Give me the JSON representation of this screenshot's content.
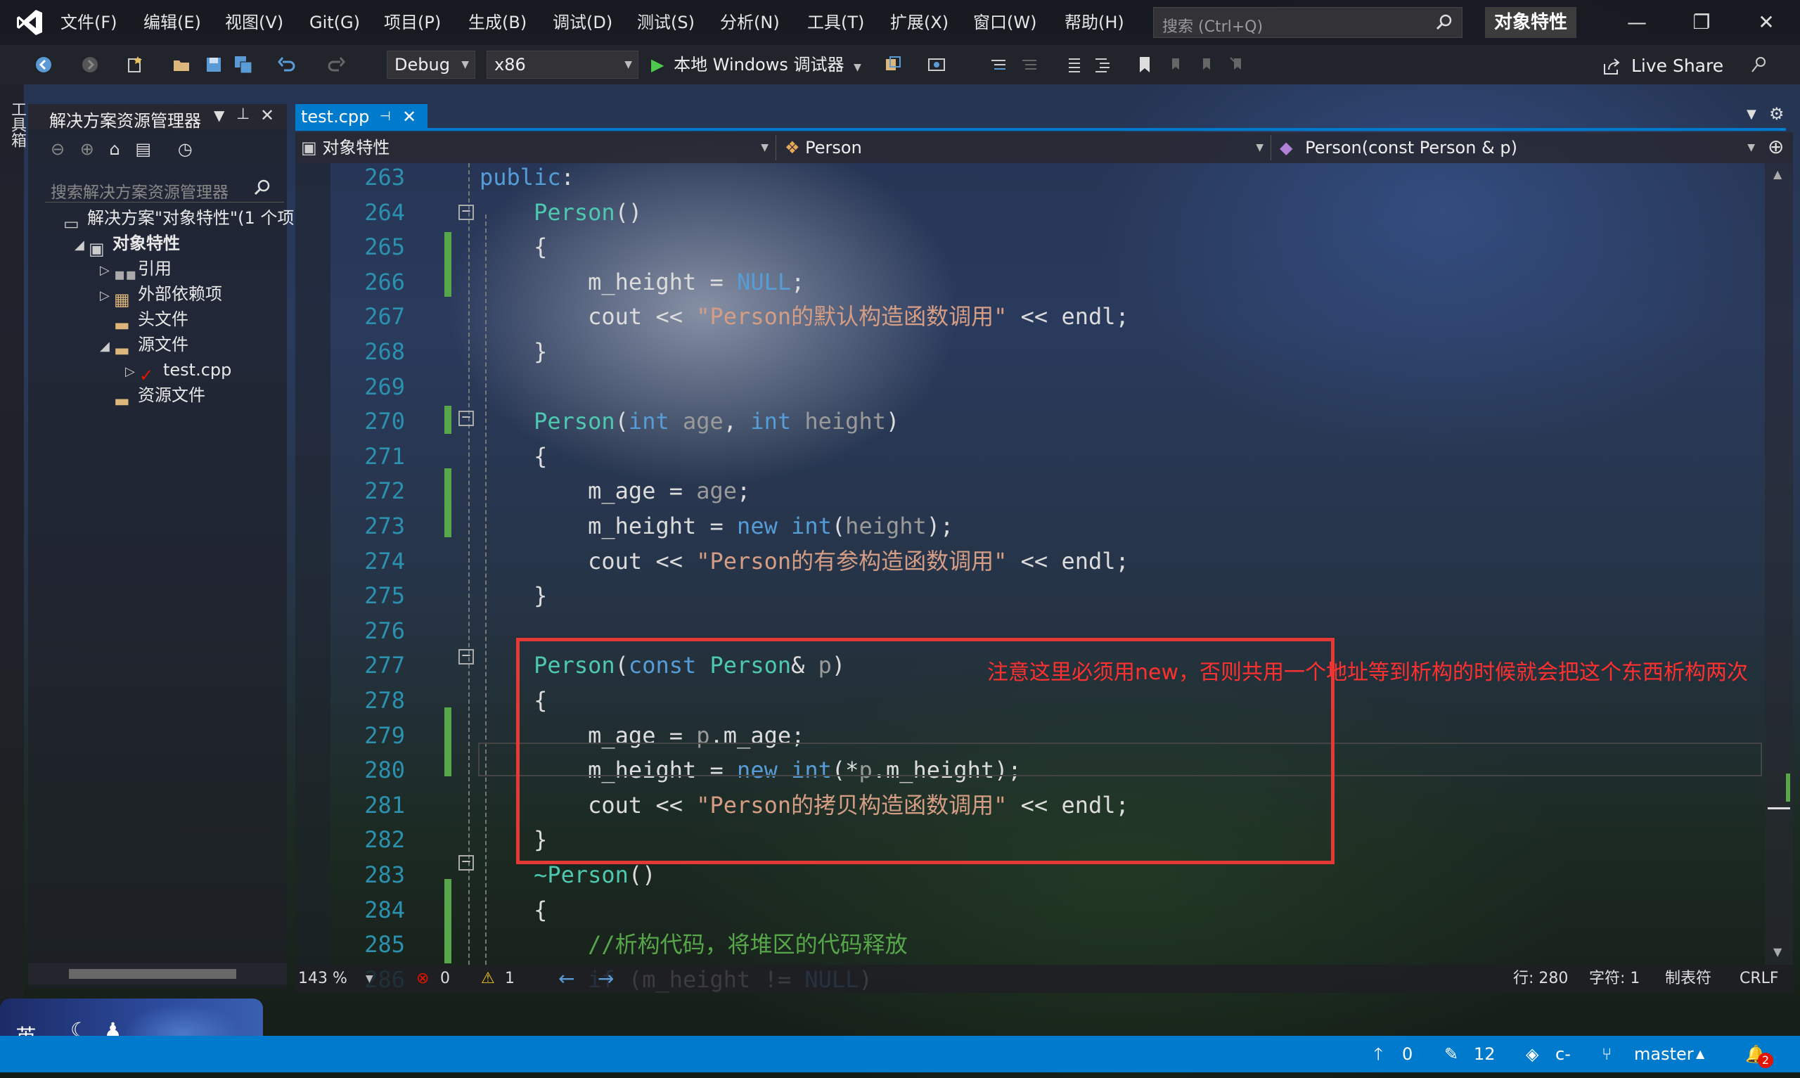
{
  "menu": [
    "文件(F)",
    "编辑(E)",
    "视图(V)",
    "Git(G)",
    "项目(P)",
    "生成(B)",
    "调试(D)",
    "测试(S)",
    "分析(N)",
    "工具(T)",
    "扩展(X)",
    "窗口(W)",
    "帮助(H)"
  ],
  "search": {
    "placeholder": "搜索 (Ctrl+Q)"
  },
  "title": "对象特性",
  "window_buttons": {
    "minimize": "—",
    "restore": "❐",
    "close": "✕"
  },
  "toolbar": {
    "config": "Debug",
    "platform": "x86",
    "run_label": "本地 Windows 调试器",
    "live_share": "Live Share"
  },
  "toolstrip_label": "工具箱",
  "solution_explorer": {
    "title": "解决方案资源管理器",
    "search_placeholder": "搜索解决方案资源管理器",
    "items": [
      {
        "label": "解决方案\"对象特性\"(1 个项",
        "depth": 0,
        "arrow": ""
      },
      {
        "label": "对象特性",
        "depth": 1,
        "arrow": "◢"
      },
      {
        "label": "引用",
        "depth": 2,
        "arrow": "▷"
      },
      {
        "label": "外部依赖项",
        "depth": 2,
        "arrow": "▷"
      },
      {
        "label": "头文件",
        "depth": 2,
        "arrow": ""
      },
      {
        "label": "源文件",
        "depth": 2,
        "arrow": "◢"
      },
      {
        "label": "test.cpp",
        "depth": 3,
        "arrow": "▷"
      },
      {
        "label": "资源文件",
        "depth": 2,
        "arrow": ""
      }
    ]
  },
  "editor": {
    "tab": "test.cpp",
    "nav_project": "对象特性",
    "nav_class": "Person",
    "nav_member": "Person(const Person & p)",
    "lines": [
      {
        "n": "263",
        "text": "public:"
      },
      {
        "n": "264",
        "text": "    Person()"
      },
      {
        "n": "265",
        "text": "    {"
      },
      {
        "n": "266",
        "text": "        m_height = NULL;"
      },
      {
        "n": "267",
        "text": "        cout << \"Person的默认构造函数调用\" << endl;"
      },
      {
        "n": "268",
        "text": "    }"
      },
      {
        "n": "269",
        "text": ""
      },
      {
        "n": "270",
        "text": "    Person(int age, int height)"
      },
      {
        "n": "271",
        "text": "    {"
      },
      {
        "n": "272",
        "text": "        m_age = age;"
      },
      {
        "n": "273",
        "text": "        m_height = new int(height);"
      },
      {
        "n": "274",
        "text": "        cout << \"Person的有参构造函数调用\" << endl;"
      },
      {
        "n": "275",
        "text": "    }"
      },
      {
        "n": "276",
        "text": ""
      },
      {
        "n": "277",
        "text": "    Person(const Person& p)"
      },
      {
        "n": "278",
        "text": "    {"
      },
      {
        "n": "279",
        "text": "        m_age = p.m_age;"
      },
      {
        "n": "280",
        "text": "        m_height = new int(*p.m_height);"
      },
      {
        "n": "281",
        "text": "        cout << \"Person的拷贝构造函数调用\" << endl;"
      },
      {
        "n": "282",
        "text": "    }"
      },
      {
        "n": "283",
        "text": "    ~Person()"
      },
      {
        "n": "284",
        "text": "    {"
      },
      {
        "n": "285",
        "text": "        //析构代码，将堆区的代码释放"
      },
      {
        "n": "286",
        "text": "        if (m_height != NULL)"
      }
    ],
    "annotation": "注意这里必须用new，否则共用一个地址等到析构的时候就会把这个东西析构两次",
    "zoom": "143 %",
    "errors": "0",
    "warnings": "1",
    "line": "行: 280",
    "char": "字符: 1",
    "indent": "制表符",
    "eol": "CRLF"
  },
  "statusbar": {
    "push": "0",
    "edits": "12",
    "repo": "c-",
    "branch": "master",
    "notifications": "2"
  },
  "ime": "英",
  "colors": {
    "accent": "#007acc",
    "annotation": "#e53935"
  }
}
